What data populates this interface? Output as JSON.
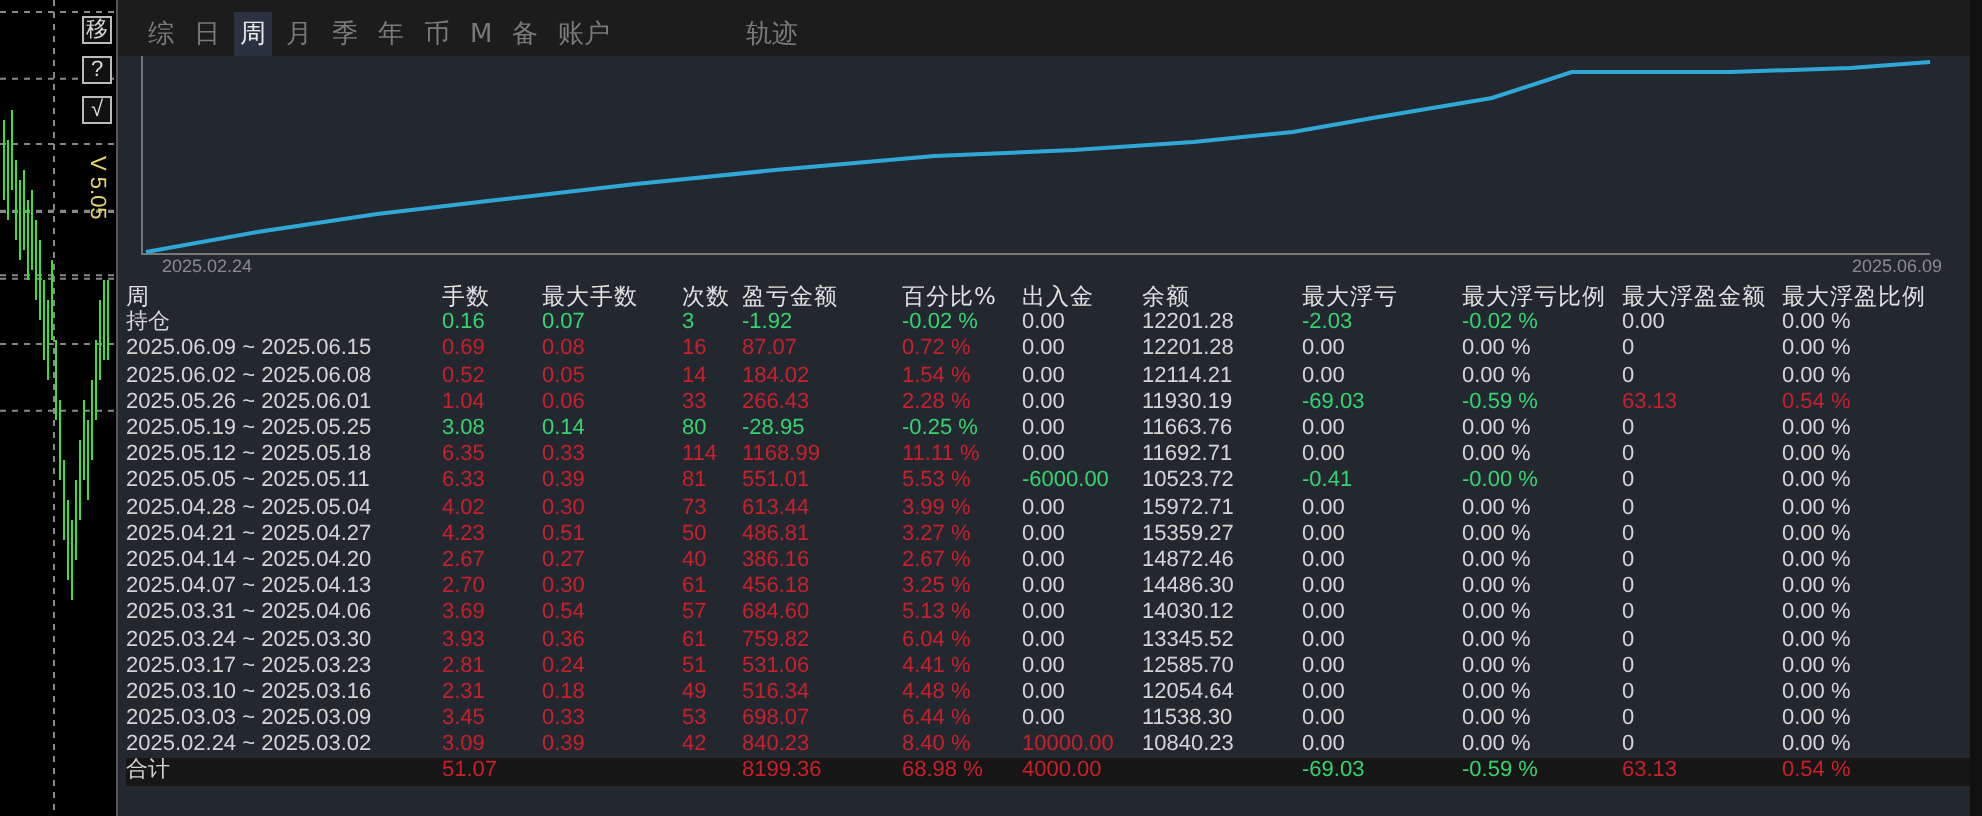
{
  "side_toolbar": {
    "buttons": [
      "移",
      "?",
      "√"
    ],
    "version": "V 5.05"
  },
  "tabs": [
    {
      "label": "综",
      "selected": false
    },
    {
      "label": "日",
      "selected": false
    },
    {
      "label": "周",
      "selected": true
    },
    {
      "label": "月",
      "selected": false
    },
    {
      "label": "季",
      "selected": false
    },
    {
      "label": "年",
      "selected": false
    },
    {
      "label": "币",
      "selected": false
    },
    {
      "label": "M",
      "selected": false
    },
    {
      "label": "备",
      "selected": false
    },
    {
      "label": "账户",
      "selected": false
    },
    {
      "label": "轨迹",
      "selected": false
    }
  ],
  "equity_chart": {
    "x_start": "2025.02.24",
    "x_end": "2025.06.09"
  },
  "table": {
    "columns": [
      "周",
      "手数",
      "最大手数",
      "次数",
      "盈亏金额",
      "百分比%",
      "出入金",
      "余额",
      "最大浮亏",
      "最大浮亏比例",
      "最大浮盈金额",
      "最大浮盈比例"
    ],
    "rows": [
      {
        "cells": [
          {
            "text": "持仓"
          },
          {
            "text": "0.16",
            "color": "#35d46f"
          },
          {
            "text": "0.07",
            "color": "#35d46f"
          },
          {
            "text": "3",
            "color": "#35d46f"
          },
          {
            "text": "-1.92",
            "color": "#35d46f"
          },
          {
            "text": "-0.02 %",
            "color": "#35d46f"
          },
          {
            "text": "0.00"
          },
          {
            "text": "12201.28"
          },
          {
            "text": "-2.03",
            "color": "#35d46f"
          },
          {
            "text": "-0.02 %",
            "color": "#35d46f"
          },
          {
            "text": "0.00"
          },
          {
            "text": "0.00 %"
          }
        ]
      },
      {
        "cells": [
          {
            "text": "2025.06.09 ~ 2025.06.15"
          },
          {
            "text": "0.69",
            "color": "#c9202a"
          },
          {
            "text": "0.08",
            "color": "#c9202a"
          },
          {
            "text": "16",
            "color": "#c9202a"
          },
          {
            "text": "87.07",
            "color": "#c9202a"
          },
          {
            "text": "0.72 %",
            "color": "#c9202a"
          },
          {
            "text": "0.00"
          },
          {
            "text": "12201.28"
          },
          {
            "text": "0.00"
          },
          {
            "text": "0.00 %"
          },
          {
            "text": "0"
          },
          {
            "text": "0.00 %"
          }
        ]
      },
      {
        "cells": [
          {
            "text": "2025.06.02 ~ 2025.06.08"
          },
          {
            "text": "0.52",
            "color": "#c9202a"
          },
          {
            "text": "0.05",
            "color": "#c9202a"
          },
          {
            "text": "14",
            "color": "#c9202a"
          },
          {
            "text": "184.02",
            "color": "#c9202a"
          },
          {
            "text": "1.54 %",
            "color": "#c9202a"
          },
          {
            "text": "0.00"
          },
          {
            "text": "12114.21"
          },
          {
            "text": "0.00"
          },
          {
            "text": "0.00 %"
          },
          {
            "text": "0"
          },
          {
            "text": "0.00 %"
          }
        ]
      },
      {
        "cells": [
          {
            "text": "2025.05.26 ~ 2025.06.01"
          },
          {
            "text": "1.04",
            "color": "#c9202a"
          },
          {
            "text": "0.06",
            "color": "#c9202a"
          },
          {
            "text": "33",
            "color": "#c9202a"
          },
          {
            "text": "266.43",
            "color": "#c9202a"
          },
          {
            "text": "2.28 %",
            "color": "#c9202a"
          },
          {
            "text": "0.00"
          },
          {
            "text": "11930.19"
          },
          {
            "text": "-69.03",
            "color": "#35d46f"
          },
          {
            "text": "-0.59 %",
            "color": "#35d46f"
          },
          {
            "text": "63.13",
            "color": "#c9202a"
          },
          {
            "text": "0.54 %",
            "color": "#c9202a"
          }
        ]
      },
      {
        "cells": [
          {
            "text": "2025.05.19 ~ 2025.05.25"
          },
          {
            "text": "3.08",
            "color": "#35d46f"
          },
          {
            "text": "0.14",
            "color": "#35d46f"
          },
          {
            "text": "80",
            "color": "#35d46f"
          },
          {
            "text": "-28.95",
            "color": "#35d46f"
          },
          {
            "text": "-0.25 %",
            "color": "#35d46f"
          },
          {
            "text": "0.00"
          },
          {
            "text": "11663.76"
          },
          {
            "text": "0.00"
          },
          {
            "text": "0.00 %"
          },
          {
            "text": "0"
          },
          {
            "text": "0.00 %"
          }
        ]
      },
      {
        "cells": [
          {
            "text": "2025.05.12 ~ 2025.05.18"
          },
          {
            "text": "6.35",
            "color": "#c9202a"
          },
          {
            "text": "0.33",
            "color": "#c9202a"
          },
          {
            "text": "114",
            "color": "#c9202a"
          },
          {
            "text": "1168.99",
            "color": "#c9202a"
          },
          {
            "text": "11.11 %",
            "color": "#c9202a"
          },
          {
            "text": "0.00"
          },
          {
            "text": "11692.71"
          },
          {
            "text": "0.00"
          },
          {
            "text": "0.00 %"
          },
          {
            "text": "0"
          },
          {
            "text": "0.00 %"
          }
        ]
      },
      {
        "cells": [
          {
            "text": "2025.05.05 ~ 2025.05.11"
          },
          {
            "text": "6.33",
            "color": "#c9202a"
          },
          {
            "text": "0.39",
            "color": "#c9202a"
          },
          {
            "text": "81",
            "color": "#c9202a"
          },
          {
            "text": "551.01",
            "color": "#c9202a"
          },
          {
            "text": "5.53 %",
            "color": "#c9202a"
          },
          {
            "text": "-6000.00",
            "color": "#35d46f"
          },
          {
            "text": "10523.72"
          },
          {
            "text": "-0.41",
            "color": "#35d46f"
          },
          {
            "text": "-0.00 %",
            "color": "#35d46f"
          },
          {
            "text": "0"
          },
          {
            "text": "0.00 %"
          }
        ]
      },
      {
        "cells": [
          {
            "text": "2025.04.28 ~ 2025.05.04"
          },
          {
            "text": "4.02",
            "color": "#c9202a"
          },
          {
            "text": "0.30",
            "color": "#c9202a"
          },
          {
            "text": "73",
            "color": "#c9202a"
          },
          {
            "text": "613.44",
            "color": "#c9202a"
          },
          {
            "text": "3.99 %",
            "color": "#c9202a"
          },
          {
            "text": "0.00"
          },
          {
            "text": "15972.71"
          },
          {
            "text": "0.00"
          },
          {
            "text": "0.00 %"
          },
          {
            "text": "0"
          },
          {
            "text": "0.00 %"
          }
        ]
      },
      {
        "cells": [
          {
            "text": "2025.04.21 ~ 2025.04.27"
          },
          {
            "text": "4.23",
            "color": "#c9202a"
          },
          {
            "text": "0.51",
            "color": "#c9202a"
          },
          {
            "text": "50",
            "color": "#c9202a"
          },
          {
            "text": "486.81",
            "color": "#c9202a"
          },
          {
            "text": "3.27 %",
            "color": "#c9202a"
          },
          {
            "text": "0.00"
          },
          {
            "text": "15359.27"
          },
          {
            "text": "0.00"
          },
          {
            "text": "0.00 %"
          },
          {
            "text": "0"
          },
          {
            "text": "0.00 %"
          }
        ]
      },
      {
        "cells": [
          {
            "text": "2025.04.14 ~ 2025.04.20"
          },
          {
            "text": "2.67",
            "color": "#c9202a"
          },
          {
            "text": "0.27",
            "color": "#c9202a"
          },
          {
            "text": "40",
            "color": "#c9202a"
          },
          {
            "text": "386.16",
            "color": "#c9202a"
          },
          {
            "text": "2.67 %",
            "color": "#c9202a"
          },
          {
            "text": "0.00"
          },
          {
            "text": "14872.46"
          },
          {
            "text": "0.00"
          },
          {
            "text": "0.00 %"
          },
          {
            "text": "0"
          },
          {
            "text": "0.00 %"
          }
        ]
      },
      {
        "cells": [
          {
            "text": "2025.04.07 ~ 2025.04.13"
          },
          {
            "text": "2.70",
            "color": "#c9202a"
          },
          {
            "text": "0.30",
            "color": "#c9202a"
          },
          {
            "text": "61",
            "color": "#c9202a"
          },
          {
            "text": "456.18",
            "color": "#c9202a"
          },
          {
            "text": "3.25 %",
            "color": "#c9202a"
          },
          {
            "text": "0.00"
          },
          {
            "text": "14486.30"
          },
          {
            "text": "0.00"
          },
          {
            "text": "0.00 %"
          },
          {
            "text": "0"
          },
          {
            "text": "0.00 %"
          }
        ]
      },
      {
        "cells": [
          {
            "text": "2025.03.31 ~ 2025.04.06"
          },
          {
            "text": "3.69",
            "color": "#c9202a"
          },
          {
            "text": "0.54",
            "color": "#c9202a"
          },
          {
            "text": "57",
            "color": "#c9202a"
          },
          {
            "text": "684.60",
            "color": "#c9202a"
          },
          {
            "text": "5.13 %",
            "color": "#c9202a"
          },
          {
            "text": "0.00"
          },
          {
            "text": "14030.12"
          },
          {
            "text": "0.00"
          },
          {
            "text": "0.00 %"
          },
          {
            "text": "0"
          },
          {
            "text": "0.00 %"
          }
        ]
      },
      {
        "cells": [
          {
            "text": "2025.03.24 ~ 2025.03.30"
          },
          {
            "text": "3.93",
            "color": "#c9202a"
          },
          {
            "text": "0.36",
            "color": "#c9202a"
          },
          {
            "text": "61",
            "color": "#c9202a"
          },
          {
            "text": "759.82",
            "color": "#c9202a"
          },
          {
            "text": "6.04 %",
            "color": "#c9202a"
          },
          {
            "text": "0.00"
          },
          {
            "text": "13345.52"
          },
          {
            "text": "0.00"
          },
          {
            "text": "0.00 %"
          },
          {
            "text": "0"
          },
          {
            "text": "0.00 %"
          }
        ]
      },
      {
        "cells": [
          {
            "text": "2025.03.17 ~ 2025.03.23"
          },
          {
            "text": "2.81",
            "color": "#c9202a"
          },
          {
            "text": "0.24",
            "color": "#c9202a"
          },
          {
            "text": "51",
            "color": "#c9202a"
          },
          {
            "text": "531.06",
            "color": "#c9202a"
          },
          {
            "text": "4.41 %",
            "color": "#c9202a"
          },
          {
            "text": "0.00"
          },
          {
            "text": "12585.70"
          },
          {
            "text": "0.00"
          },
          {
            "text": "0.00 %"
          },
          {
            "text": "0"
          },
          {
            "text": "0.00 %"
          }
        ]
      },
      {
        "cells": [
          {
            "text": "2025.03.10 ~ 2025.03.16"
          },
          {
            "text": "2.31",
            "color": "#c9202a"
          },
          {
            "text": "0.18",
            "color": "#c9202a"
          },
          {
            "text": "49",
            "color": "#c9202a"
          },
          {
            "text": "516.34",
            "color": "#c9202a"
          },
          {
            "text": "4.48 %",
            "color": "#c9202a"
          },
          {
            "text": "0.00"
          },
          {
            "text": "12054.64"
          },
          {
            "text": "0.00"
          },
          {
            "text": "0.00 %"
          },
          {
            "text": "0"
          },
          {
            "text": "0.00 %"
          }
        ]
      },
      {
        "cells": [
          {
            "text": "2025.03.03 ~ 2025.03.09"
          },
          {
            "text": "3.45",
            "color": "#c9202a"
          },
          {
            "text": "0.33",
            "color": "#c9202a"
          },
          {
            "text": "53",
            "color": "#c9202a"
          },
          {
            "text": "698.07",
            "color": "#c9202a"
          },
          {
            "text": "6.44 %",
            "color": "#c9202a"
          },
          {
            "text": "0.00"
          },
          {
            "text": "11538.30"
          },
          {
            "text": "0.00"
          },
          {
            "text": "0.00 %"
          },
          {
            "text": "0"
          },
          {
            "text": "0.00 %"
          }
        ]
      },
      {
        "cells": [
          {
            "text": "2025.02.24 ~ 2025.03.02"
          },
          {
            "text": "3.09",
            "color": "#c9202a"
          },
          {
            "text": "0.39",
            "color": "#c9202a"
          },
          {
            "text": "42",
            "color": "#c9202a"
          },
          {
            "text": "840.23",
            "color": "#c9202a"
          },
          {
            "text": "8.40 %",
            "color": "#c9202a"
          },
          {
            "text": "10000.00",
            "color": "#c9202a"
          },
          {
            "text": "10840.23"
          },
          {
            "text": "0.00"
          },
          {
            "text": "0.00 %"
          },
          {
            "text": "0"
          },
          {
            "text": "0.00 %"
          }
        ]
      }
    ],
    "total": {
      "cells": [
        {
          "text": "合计"
        },
        {
          "text": "51.07",
          "color": "#c9202a"
        },
        null,
        null,
        {
          "text": "8199.36",
          "color": "#c9202a"
        },
        {
          "text": "68.98 %",
          "color": "#c9202a"
        },
        {
          "text": "4000.00",
          "color": "#c9202a"
        },
        null,
        {
          "text": "-69.03",
          "color": "#35d46f"
        },
        {
          "text": "-0.59 %",
          "color": "#35d46f"
        },
        {
          "text": "63.13",
          "color": "#c9202a"
        },
        {
          "text": "0.54 %",
          "color": "#c9202a"
        }
      ]
    }
  }
}
